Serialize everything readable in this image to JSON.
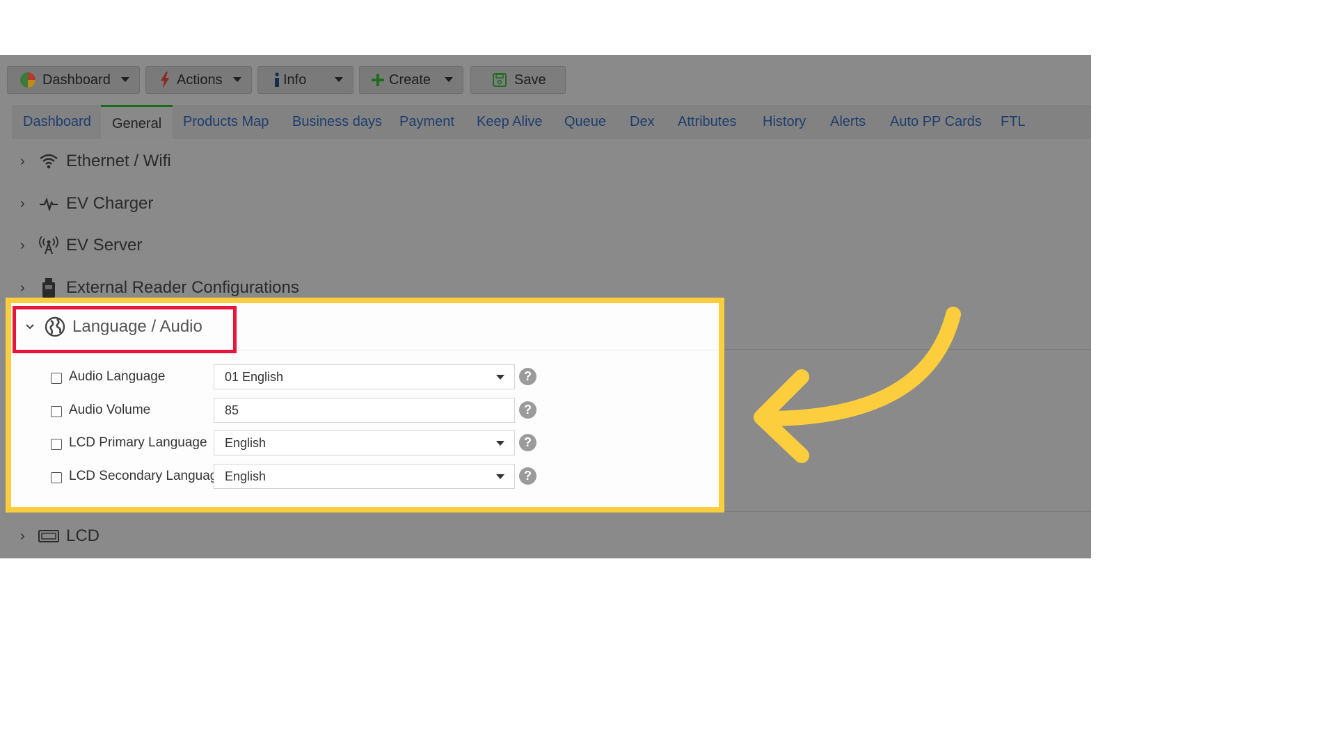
{
  "toolbar": {
    "dashboard_label": "Dashboard",
    "actions_label": "Actions",
    "info_label": "Info",
    "create_label": "Create",
    "save_label": "Save",
    "icons": [
      "pie-chart-icon",
      "lightning-icon",
      "info-icon",
      "plus-icon",
      "floppy-disk-icon"
    ]
  },
  "tabs": [
    {
      "label": "Dashboard",
      "active": false
    },
    {
      "label": "General",
      "active": true
    },
    {
      "label": "Products Map",
      "active": false
    },
    {
      "label": "Business days",
      "active": false
    },
    {
      "label": "Payment",
      "active": false
    },
    {
      "label": "Keep Alive",
      "active": false
    },
    {
      "label": "Queue",
      "active": false
    },
    {
      "label": "Dex",
      "active": false
    },
    {
      "label": "Attributes",
      "active": false
    },
    {
      "label": "History",
      "active": false
    },
    {
      "label": "Alerts",
      "active": false
    },
    {
      "label": "Auto PP Cards",
      "active": false
    },
    {
      "label": "FTL",
      "active": false
    }
  ],
  "sections": [
    {
      "label": "Ethernet / Wifi",
      "icon": "wifi-icon",
      "expanded": false
    },
    {
      "label": "EV Charger",
      "icon": "pulse-icon",
      "expanded": false
    },
    {
      "label": "EV Server",
      "icon": "antenna-icon",
      "expanded": false
    },
    {
      "label": "External Reader Configurations",
      "icon": "usb-reader-icon",
      "expanded": false
    },
    {
      "label": "Language / Audio",
      "icon": "globe-icon",
      "expanded": true
    },
    {
      "label": "LCD",
      "icon": "lcd-icon",
      "expanded": false
    }
  ],
  "language_audio": {
    "fields": [
      {
        "label": "Audio Language",
        "value": "01 English",
        "type": "select",
        "checked": false
      },
      {
        "label": "Audio Volume",
        "value": "85",
        "type": "text",
        "checked": false
      },
      {
        "label": "LCD Primary Language",
        "value": "English",
        "type": "select",
        "checked": false
      },
      {
        "label": "LCD Secondary Language",
        "value": "English",
        "type": "select",
        "checked": false
      }
    ],
    "help_glyph": "?"
  },
  "colors": {
    "highlight_box": "#fcce3e",
    "highlight_header": "#e8173a",
    "arrow": "#fcce3e",
    "active_tab_border": "#1a6b1a"
  }
}
